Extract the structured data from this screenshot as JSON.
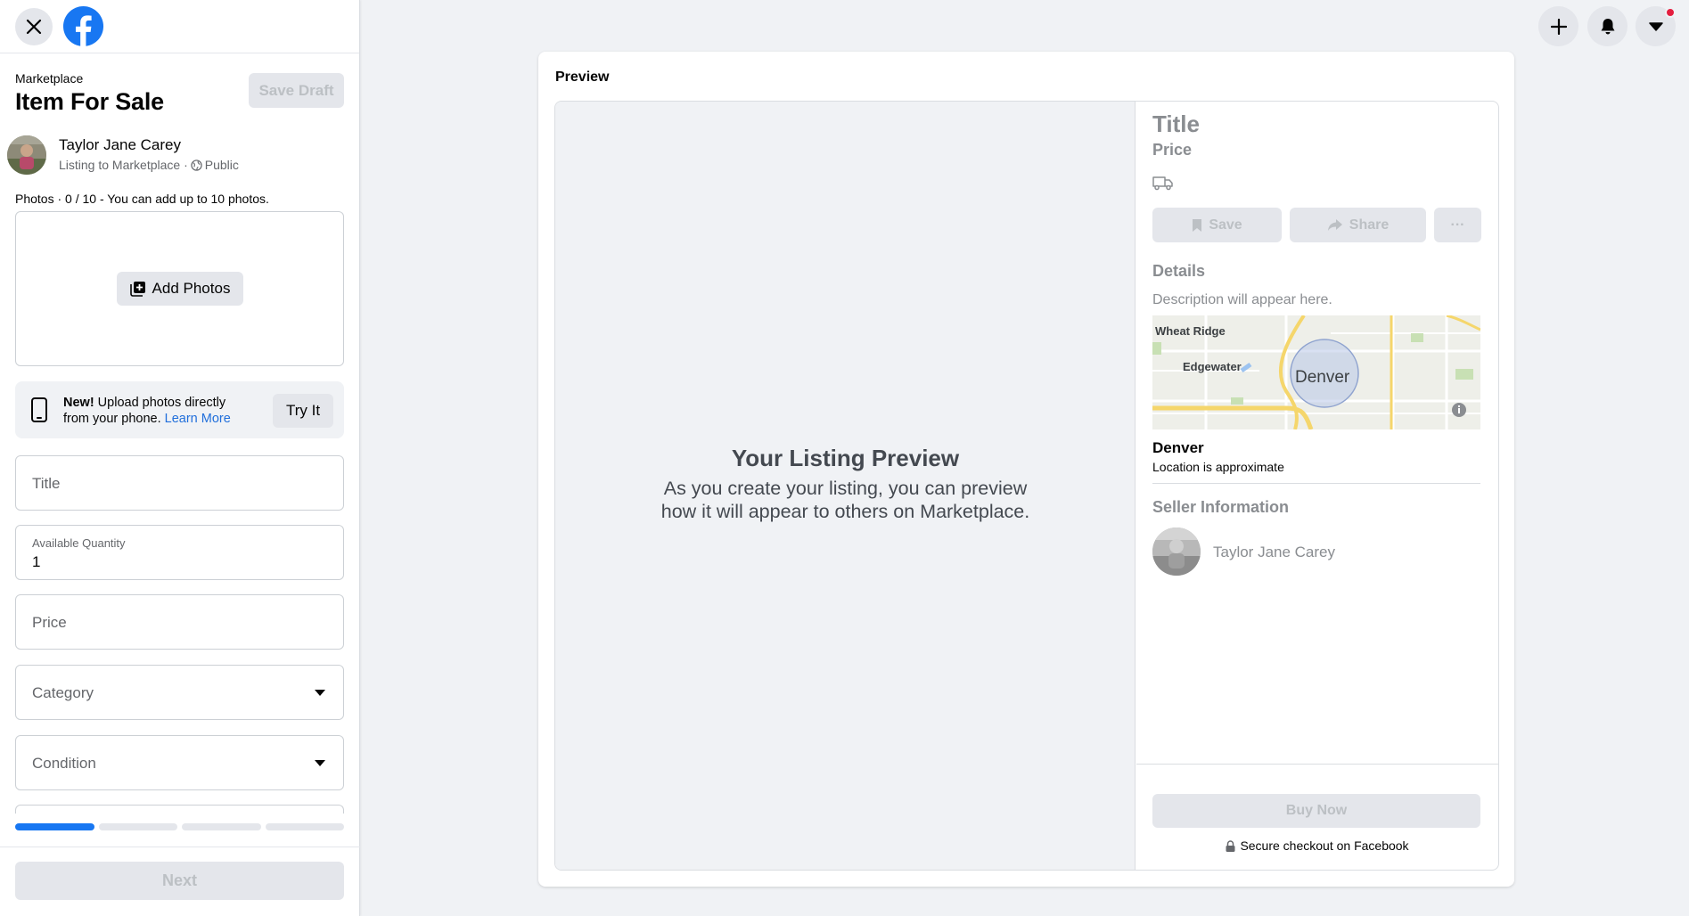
{
  "header": {
    "close_icon": "close-icon",
    "logo": "facebook-logo",
    "breadcrumb": "Marketplace",
    "title": "Item For Sale",
    "save_draft_label": "Save Draft"
  },
  "user": {
    "name": "Taylor Jane Carey",
    "listing_to": "Listing to Marketplace ·",
    "audience": "Public"
  },
  "photos": {
    "label_prefix": "Photos · 0 / 10",
    "label_suffix": " - You can add up to 10 photos.",
    "add_photos_label": "Add Photos"
  },
  "phone_tip": {
    "new_label": "New!",
    "text": " Upload photos directly from your phone. ",
    "learn_more": "Learn More",
    "try_it_label": "Try It"
  },
  "form": {
    "title_placeholder": "Title",
    "quantity_label": "Available Quantity",
    "quantity_value": "1",
    "price_placeholder": "Price",
    "category_placeholder": "Category",
    "condition_placeholder": "Condition"
  },
  "progress": {
    "steps": 4,
    "current": 1
  },
  "footer": {
    "next_label": "Next"
  },
  "top_right": {
    "create_icon": "plus-icon",
    "notifications_icon": "bell-icon",
    "account_icon": "caret-down-icon"
  },
  "preview": {
    "label": "Preview",
    "heading": "Your Listing Preview",
    "body_line1": "As you create your listing, you can preview",
    "body_line2": "how it will appear to others on Marketplace.",
    "title": "Title",
    "price": "Price",
    "save_label": "Save",
    "share_label": "Share",
    "more_label": "···",
    "details_label": "Details",
    "description": "Description will appear here.",
    "map_labels": {
      "city1": "Wheat Ridge",
      "city2": "Edgewater",
      "city3": "Denver"
    },
    "location_name": "Denver",
    "location_sub": "Location is approximate",
    "seller_heading": "Seller Information",
    "seller_name": "Taylor Jane Carey",
    "buy_now_label": "Buy Now",
    "secure_checkout": "Secure checkout on Facebook"
  },
  "colors": {
    "brand_blue": "#1877f2",
    "link_blue": "#216fdb",
    "notification_red": "#e41e3f",
    "disabled_text": "#bcc0c4",
    "button_gray": "#e4e6eb"
  }
}
